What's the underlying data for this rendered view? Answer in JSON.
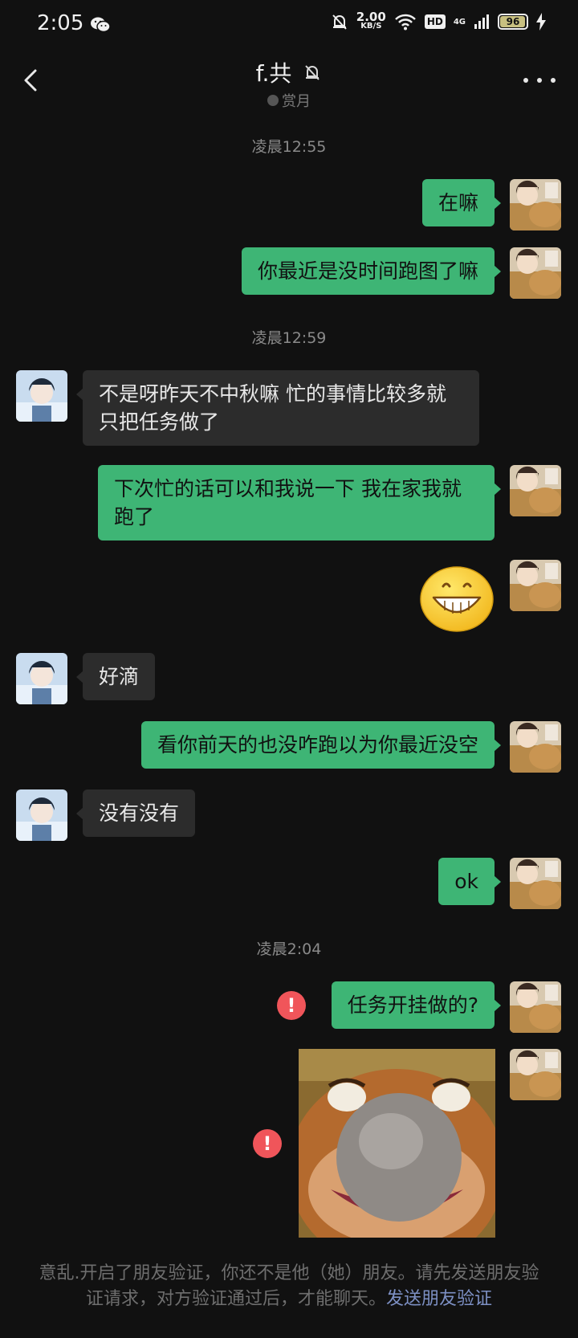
{
  "status_bar": {
    "time": "2:05",
    "net_speed_value": "2.00",
    "net_speed_unit": "KB/S",
    "hd": "HD",
    "network": "4G",
    "battery": "96",
    "battery_level": 0.96
  },
  "header": {
    "title": "f.共",
    "subtitle": "赏月"
  },
  "timestamps": [
    "凌晨12:55",
    "凌晨12:59",
    "凌晨2:04"
  ],
  "messages": [
    {
      "text": "在嘛"
    },
    {
      "text": "你最近是没时间跑图了嘛"
    },
    {
      "text": "不是呀昨天不中秋嘛 忙的事情比较多就只把任务做了"
    },
    {
      "text": "下次忙的话可以和我说一下 我在家我就跑了"
    },
    {
      "text": "😁"
    },
    {
      "text": "好滴"
    },
    {
      "text": "看你前天的也没咋跑以为你最近没空"
    },
    {
      "text": "没有没有"
    },
    {
      "text": "ok"
    },
    {
      "text": "任务开挂做的?"
    }
  ],
  "error_mark": "!",
  "footer": {
    "notice": "意乱.开启了朋友验证，你还不是他（她）朋友。请先发送朋友验证请求，对方验证通过后，才能聊天。",
    "link": "发送朋友验证"
  },
  "colors": {
    "background": "#111111",
    "my_bubble": "#3eb575",
    "their_bubble": "#2c2c2c",
    "error": "#f0555a",
    "link": "#7d90c4"
  },
  "icons": [
    "back-arrow-icon",
    "mute-bell-icon",
    "more-dots-icon",
    "wechat-icon",
    "wifi-icon",
    "signal-icon",
    "battery-icon",
    "error-icon"
  ]
}
